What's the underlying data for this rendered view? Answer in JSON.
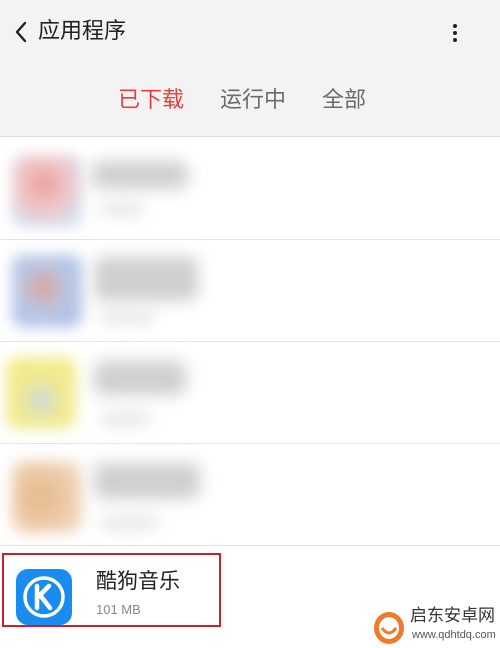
{
  "header": {
    "title": "应用程序",
    "icons": {
      "back": "chevron-left-icon",
      "more": "more-vertical-icon"
    }
  },
  "tabs": [
    {
      "label": "已下载",
      "active": true
    },
    {
      "label": "运行中",
      "active": false
    },
    {
      "label": "全部",
      "active": false
    }
  ],
  "app_list": {
    "blurred_count": 4,
    "visible_app": {
      "name": "酷狗音乐",
      "size": "101 MB",
      "icon": "kugou-k-icon"
    }
  },
  "watermark": {
    "name": "启东安卓网",
    "url": "www.qdhtdq.com"
  },
  "colors": {
    "accent": "#e63d3d",
    "highlight_border": "#cc1f2a",
    "app_icon_bg": "#1a8cf0"
  }
}
